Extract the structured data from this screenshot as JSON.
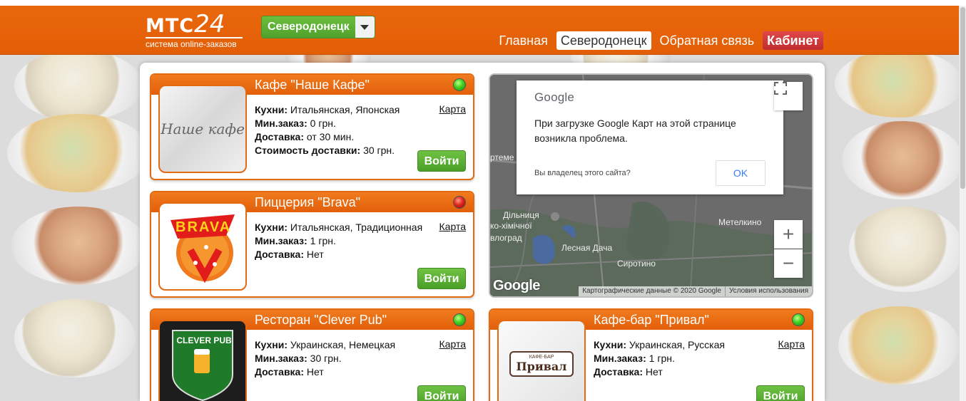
{
  "header": {
    "logo_main": "МТС",
    "logo_num": "24",
    "logo_sub": "система online-заказов",
    "city_selected": "Северодонецк",
    "nav": [
      {
        "label": "Главная"
      },
      {
        "label": "Северодонецк"
      },
      {
        "label": "Обратная связь"
      },
      {
        "label": "Кабинет"
      }
    ]
  },
  "labels": {
    "cuisines": "Кухни:",
    "min_order": "Мин.заказ:",
    "delivery": "Доставка:",
    "delivery_cost": "Стоимость доставки:",
    "map_link": "Карта",
    "enter_button": "Войти"
  },
  "restaurants": [
    {
      "name": "Кафе \"Наше Кафе\"",
      "status": "open",
      "status_color": "#2fbf1a",
      "logo_text": "Наше кафе",
      "cuisines": "Итальянская, Японская",
      "min_order": "0 грн.",
      "delivery": "от 30 мин.",
      "delivery_cost": "30 грн."
    },
    {
      "name": "Пиццерия \"Brava\"",
      "status": "closed",
      "status_color": "#d9261b",
      "logo_text": "BRAVA",
      "cuisines": "Итальянская, Традиционная",
      "min_order": "1 грн.",
      "delivery": "Нет"
    },
    {
      "name": "Ресторан \"Clever Pub\"",
      "status": "open",
      "status_color": "#2fbf1a",
      "logo_text": "CLEVER PUB",
      "cuisines": "Украинская, Немецкая",
      "min_order": "30 грн.",
      "delivery": "Нет"
    },
    {
      "name": "Кафе-бар \"Привал\"",
      "status": "open",
      "status_color": "#2fbf1a",
      "logo_text": "Привал",
      "logo_subtext": "КАФЕ-БАР",
      "cuisines": "Украинская, Русская",
      "min_order": "1 грн.",
      "delivery": "Нет"
    }
  ],
  "map": {
    "dialog_brand": "Google",
    "dialog_message": "При загрузке Google Карт на этой странице возникла проблема.",
    "dialog_owner": "Вы владелец этого сайта?",
    "dialog_ok": "OK",
    "labels": [
      "Метелкино",
      "Лесная Дача",
      "Сиротино",
      "Дільниця",
      "ко-хімічної",
      "влоград",
      "ртеме"
    ],
    "logo": "Google",
    "footer_data": "Картографические данные © 2020 Google",
    "footer_terms": "Условия использования",
    "zoom_in": "+",
    "zoom_out": "−"
  }
}
